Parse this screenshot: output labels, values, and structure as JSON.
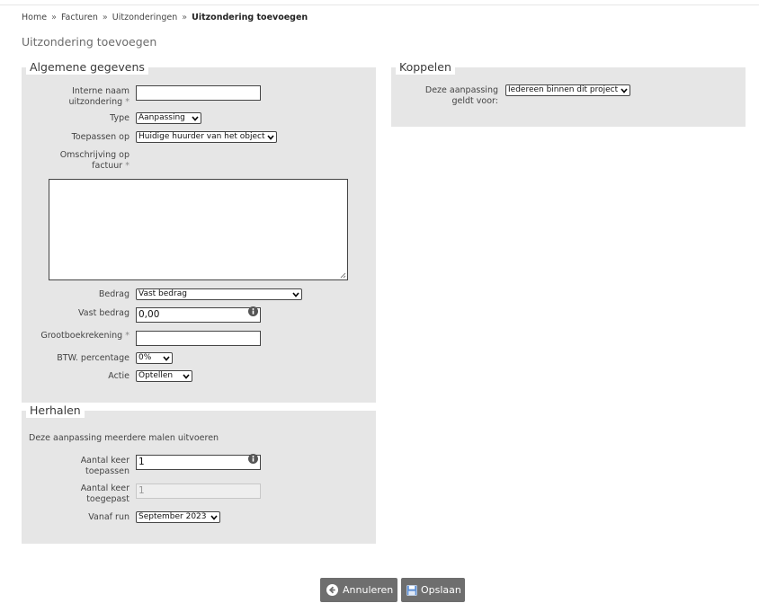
{
  "breadcrumb": {
    "items": [
      "Home",
      "Facturen",
      "Uitzonderingen"
    ],
    "separator": "»",
    "current": "Uitzondering toevoegen"
  },
  "page_title": "Uitzondering toevoegen",
  "general": {
    "legend": "Algemene gegevens",
    "internal_name": {
      "label_line1": "Interne naam",
      "label_line2": "uitzondering",
      "required": "*",
      "value": ""
    },
    "type": {
      "label": "Type",
      "selected": "Aanpassing"
    },
    "apply_on": {
      "label": "Toepassen op",
      "selected": "Huidige huurder van het object"
    },
    "description": {
      "label_line1": "Omschrijving op",
      "label_line2": "factuur",
      "required": "*",
      "value": ""
    },
    "amount": {
      "label": "Bedrag",
      "selected": "Vast bedrag"
    },
    "fixed_amount": {
      "label": "Vast bedrag",
      "value": "0,00"
    },
    "ledger": {
      "label": "Grootboekrekening",
      "required": "*",
      "value": ""
    },
    "vat": {
      "label": "BTW. percentage",
      "selected": "0%"
    },
    "action": {
      "label": "Actie",
      "selected": "Optellen"
    }
  },
  "repeat": {
    "legend": "Herhalen",
    "note": "Deze aanpassing meerdere malen uitvoeren",
    "times_apply": {
      "label_line1": "Aantal keer",
      "label_line2": "toepassen",
      "value": "1"
    },
    "times_applied": {
      "label_line1": "Aantal keer",
      "label_line2": "toegepast",
      "value": "1"
    },
    "from_run": {
      "label": "Vanaf run",
      "selected": "September 2023"
    }
  },
  "link": {
    "legend": "Koppelen",
    "applies_to": {
      "label_line1": "Deze aanpassing",
      "label_line2": "geldt voor:",
      "selected": "Iedereen binnen dit project"
    }
  },
  "buttons": {
    "cancel": "Annuleren",
    "save": "Opslaan"
  },
  "colors": {
    "panel": "#e6e6e6",
    "button": "#6e6e6e",
    "save_icon": "#5b8fd6"
  }
}
